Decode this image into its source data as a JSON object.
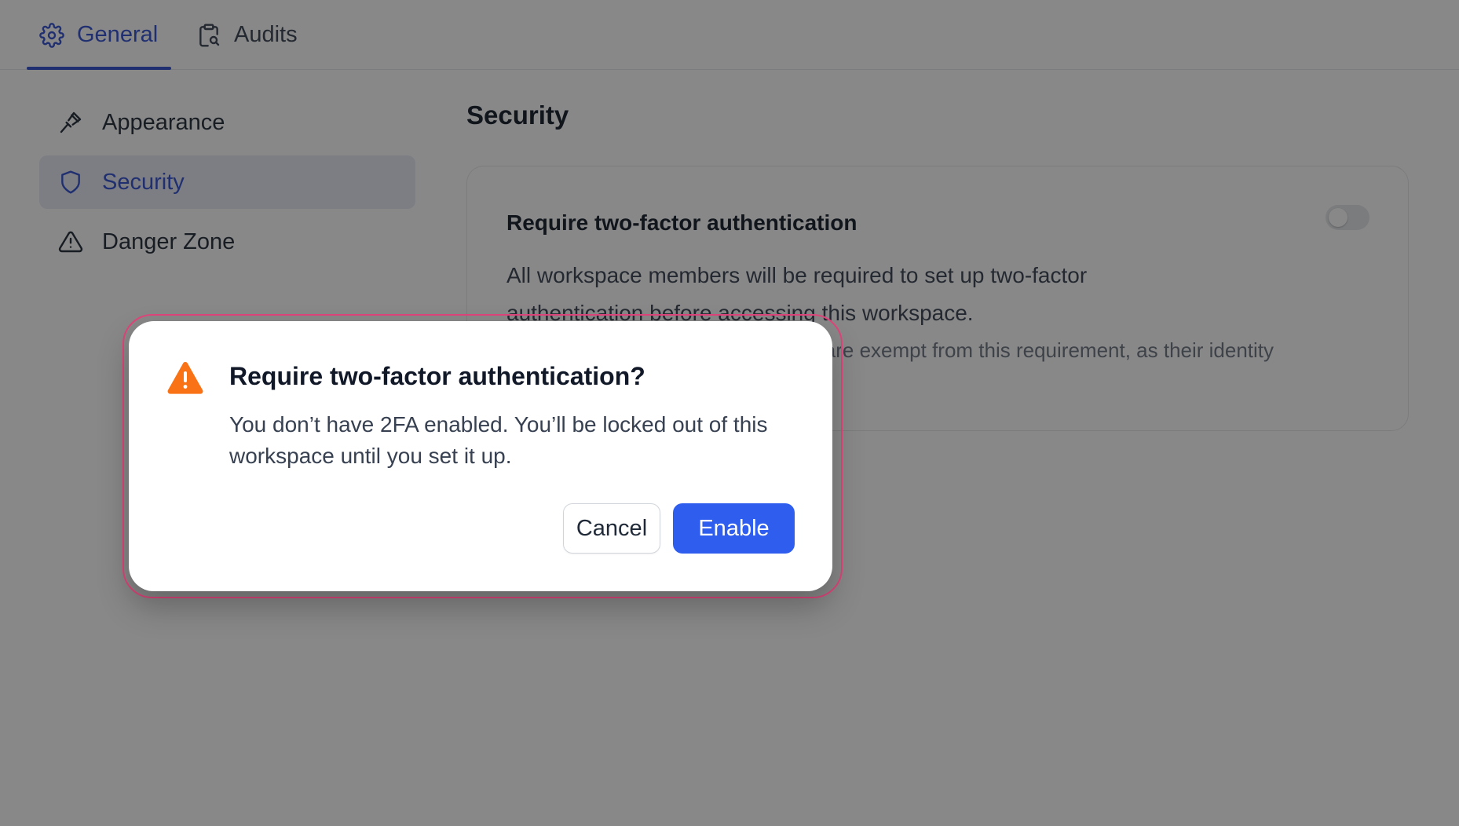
{
  "tabs": [
    {
      "label": "General",
      "icon": "gear-icon",
      "active": true
    },
    {
      "label": "Audits",
      "icon": "clipboard-search-icon",
      "active": false
    }
  ],
  "sidebar": {
    "items": [
      {
        "label": "Appearance",
        "icon": "brush-icon"
      },
      {
        "label": "Security",
        "icon": "shield-icon",
        "active": true
      },
      {
        "label": "Danger Zone",
        "icon": "warning-triangle-icon"
      }
    ]
  },
  "main": {
    "heading": "Security",
    "card": {
      "title": "Require two-factor authentication",
      "description": "All workspace members will be required to set up two-factor authentication before accessing this workspace.",
      "note_visible": "SO are exempt from this requirement, as their identity provider.",
      "toggle_on": false
    }
  },
  "modal": {
    "icon": "warning-triangle-icon",
    "title": "Require two-factor authentication?",
    "body": "You don’t have 2FA enabled. You’ll be locked out of this workspace until you set it up.",
    "cancel_label": "Cancel",
    "confirm_label": "Enable"
  },
  "colors": {
    "accent": "#2f4ccf",
    "primary_button": "#2f5eef",
    "warning": "#f97316",
    "focus_ring": "#e0457b",
    "overlay": "rgba(17,17,17,0.5)"
  }
}
